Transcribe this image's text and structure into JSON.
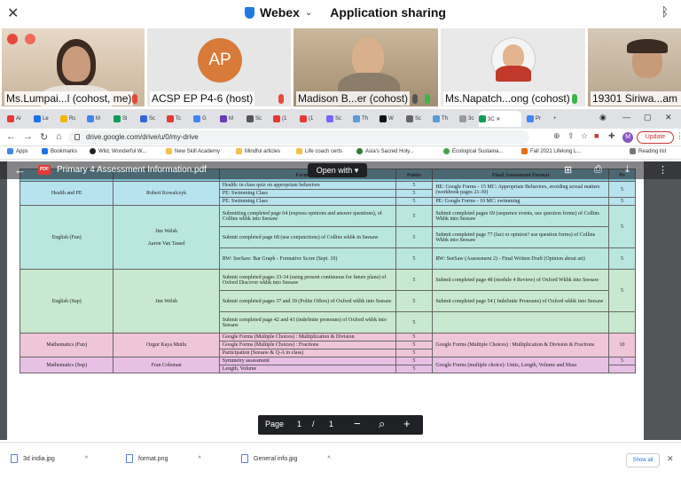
{
  "webex": {
    "app_name": "Webex",
    "mode": "Application sharing"
  },
  "participants": [
    {
      "name": "Ms.Lumpai...l (cohost, me)"
    },
    {
      "name": "ACSP EP P4-6 (host)",
      "initials": "AP"
    },
    {
      "name": "Madison B...er (cohost)"
    },
    {
      "name": "Ms.Napatch...ong (cohost)"
    },
    {
      "name": "19301 Siriwa...am (c"
    }
  ],
  "browser": {
    "url": "drive.google.com/drive/u/0/my-drive",
    "update_label": "Update",
    "profile_initial": "M",
    "bookmarks": [
      "Apps",
      "Bookmarks",
      "Wild, Wonderful W...",
      "New Skill Academy",
      "Mindful articles",
      "Life coach certs",
      "Asia's Sacred Holy...",
      "Ecological Sustaina...",
      "Fall 2021 Lifelong L...",
      "Reading list"
    ]
  },
  "pdf": {
    "badge": "PDF",
    "title": "Primary 4 Assessment Information.pdf",
    "open_with": "Open with",
    "page_label": "Page",
    "page_current": "1",
    "page_sep": "/",
    "page_total": "1"
  },
  "table": {
    "headers": {
      "formative": "Formative",
      "points": "Points",
      "final": "Final Assessment Format",
      "total": "Po"
    },
    "hpe": {
      "subject": "Health and PE",
      "teacher": "Robert Kowalczyk",
      "rows": [
        {
          "formative": "Health: in class quiz on appropriate behaviors",
          "points": "5"
        },
        {
          "formative": "PE: Swimming Class",
          "points": "5"
        },
        {
          "formative": "PE: Swimming Class",
          "points": "5"
        }
      ],
      "finals": [
        {
          "text": "HE: Google Forms - 15 MC: Appropriate Behaviors, avoiding sexual matters (workbook pages 21-30)",
          "points": "5"
        },
        {
          "text": "PE: Google Forms - 10 MC: swimming",
          "points": "5"
        }
      ]
    },
    "eng": {
      "subject": "English (Fun)",
      "teacher1": "Jim Welsh",
      "teacher2": "Aaron Van Tassel",
      "rows": [
        {
          "formative": "Submitting completed page 64 (express opinions and answer questions), of Collins wkbk into Seesaw",
          "points": "5"
        },
        {
          "formative": "Submit completed page 68 (use conjunctions) of Collins wkbk in Seesaw",
          "points": "5"
        },
        {
          "formative": "RW: SeeSaw: Bar Graph - Formative Score (Sept. 10)",
          "points": "5"
        }
      ],
      "finals": [
        {
          "text": "Submit completed pages 69 (sequence events, use question forms) of Collins Wkbk into Seesaw",
          "points": "5"
        },
        {
          "text": "Submit completed page 77 (fact or opinion? use question forms) of Collins Wkbk into Seesaw",
          "points": "5"
        },
        {
          "text": "RW: SeeSaw (Assessment 2) - Final Written Draft (Opinion about art)",
          "points": "5"
        }
      ]
    },
    "sup": {
      "subject": "English (Sup)",
      "teacher": "Jim Welsh",
      "rows": [
        {
          "formative": "Submit completed pages 33-34 (using present continuous for future plans) of Oxford Discover wkbk into Seesaw",
          "points": "5"
        },
        {
          "formative": "Submit completed pages 37 and 39 (Polite Offers) of Oxford wkbk into Seesaw",
          "points": "5"
        },
        {
          "formative": "Submit completed page 42 and 43 (indefinite pronouns) of Oxford wkbk into Seesaw",
          "points": "5"
        }
      ],
      "finals": [
        {
          "text": "Submit completed page 48 (module 4 Review) of Oxford Wkbk into Seesaw",
          "points": "5"
        },
        {
          "text": "Submit completed page 54 ( Indefinite Pronouns) of Oxford wkbk into Seesaw",
          "points": "5"
        }
      ]
    },
    "mfun": {
      "subject": "Mathematics (Fun)",
      "teacher": "Ozgur Kaya Mutlu",
      "rows": [
        {
          "formative": "Google Forms (Multiple Choices) : Multiplication & Division",
          "points": "5"
        },
        {
          "formative": "Google Forms (Multiple Choices) : Fractions",
          "points": "5"
        },
        {
          "formative": "Participation (Seesaw & Q-A in class)",
          "points": "5"
        }
      ],
      "final": {
        "text": "Google Forms (Multiple Choices) : Multiplication & Division & Fractions",
        "points": "10"
      }
    },
    "msup": {
      "subject": "Mathematics (Sup)",
      "teacher": "Fran Coleman",
      "rows": [
        {
          "formative": "Symmetry assessment",
          "points": "5"
        },
        {
          "formative": "Length, Volume",
          "points": "5"
        }
      ],
      "final": {
        "text": "Google Forms (multiple choice): Units, Length, Volume and Mass",
        "points": "5"
      }
    }
  },
  "downloads": [
    {
      "name": "3d india.jpg"
    },
    {
      "name": "format.png"
    },
    {
      "name": "General info.jpg"
    }
  ],
  "show_all": "Show all"
}
